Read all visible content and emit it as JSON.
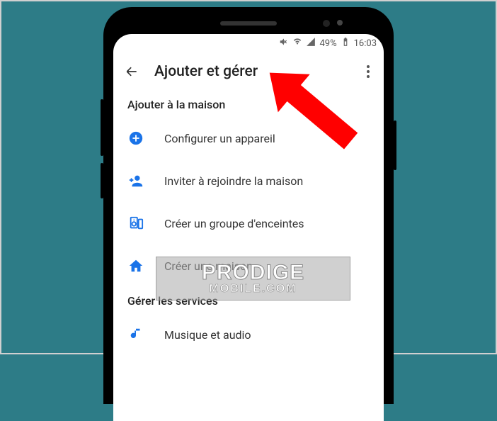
{
  "statusbar": {
    "battery_pct": "49%",
    "time": "16:03"
  },
  "header": {
    "title": "Ajouter et gérer"
  },
  "sections": {
    "add": {
      "heading": "Ajouter à la maison",
      "items": [
        {
          "label": "Configurer un appareil"
        },
        {
          "label": "Inviter à rejoindre la maison"
        },
        {
          "label": "Créer un groupe d'enceintes"
        },
        {
          "label": "Créer une maison"
        }
      ]
    },
    "manage": {
      "heading": "Gérer les services",
      "items": [
        {
          "label": "Musique et audio"
        }
      ]
    }
  },
  "watermark": {
    "line1": "PRODIGE",
    "line2": "MOBILE.COM"
  }
}
